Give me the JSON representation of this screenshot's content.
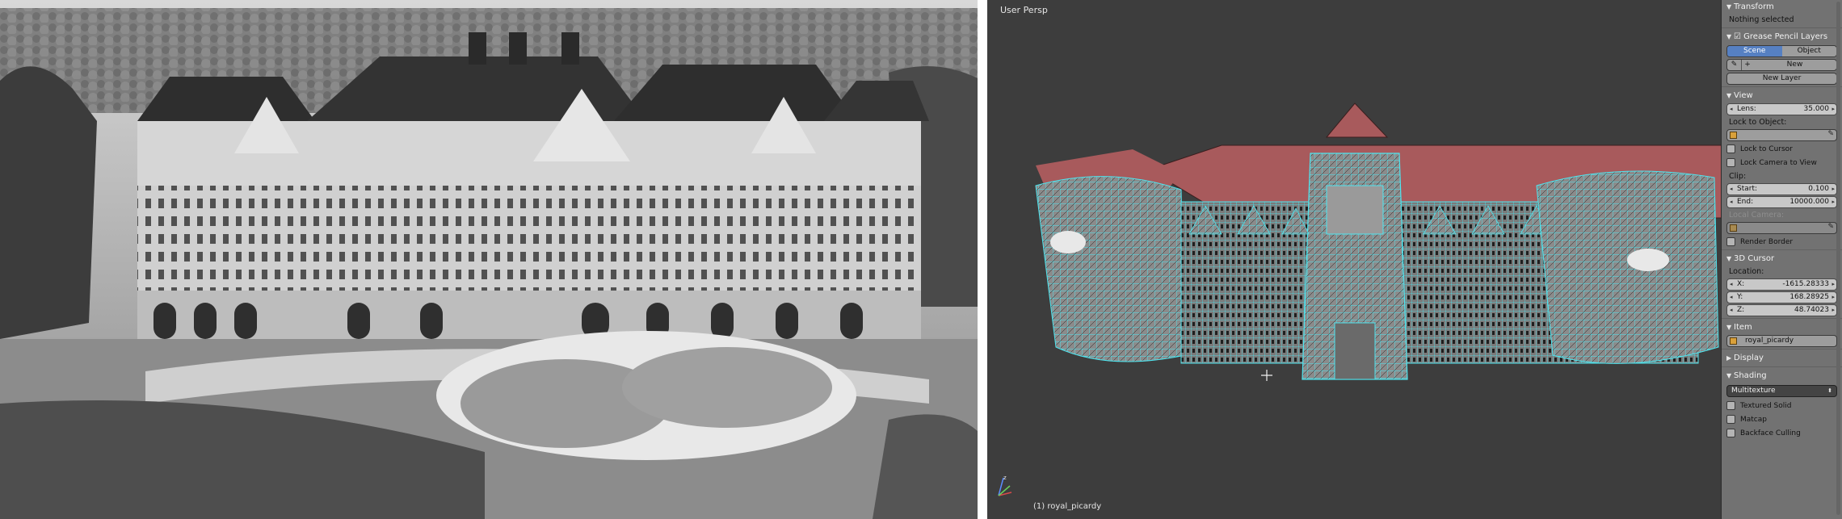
{
  "viewport": {
    "view_label": "User Persp",
    "object_label": "(1) royal_picardy",
    "background_color": "#3d3d3d",
    "roof_color": "#a85a5c",
    "wire_color": "#4ee6f0"
  },
  "panel": {
    "transform": {
      "header": "Transform",
      "status": "Nothing selected"
    },
    "grease_pencil": {
      "header": "Grease Pencil Layers",
      "tabs": [
        "Scene",
        "Object"
      ],
      "active_tab": "Scene",
      "new_label": "New",
      "new_layer_label": "New Layer"
    },
    "view": {
      "header": "View",
      "lens_label": "Lens:",
      "lens_value": "35.000",
      "lock_to_object_label": "Lock to Object:",
      "lock_to_cursor_label": "Lock to Cursor",
      "lock_camera_label": "Lock Camera to View",
      "clip_label": "Clip:",
      "clip_start_label": "Start:",
      "clip_start_value": "0.100",
      "clip_end_label": "End:",
      "clip_end_value": "10000.000",
      "local_camera_label": "Local Camera:",
      "render_border_label": "Render Border"
    },
    "cursor": {
      "header": "3D Cursor",
      "location_label": "Location:",
      "x_label": "X:",
      "x_value": "-1615.28333",
      "y_label": "Y:",
      "y_value": "168.28925",
      "z_label": "Z:",
      "z_value": "48.74023"
    },
    "item": {
      "header": "Item",
      "name": "royal_picardy"
    },
    "display": {
      "header": "Display"
    },
    "shading": {
      "header": "Shading",
      "mode": "Multitexture",
      "textured_solid_label": "Textured Solid",
      "matcap_label": "Matcap",
      "backface_label": "Backface Culling"
    }
  }
}
